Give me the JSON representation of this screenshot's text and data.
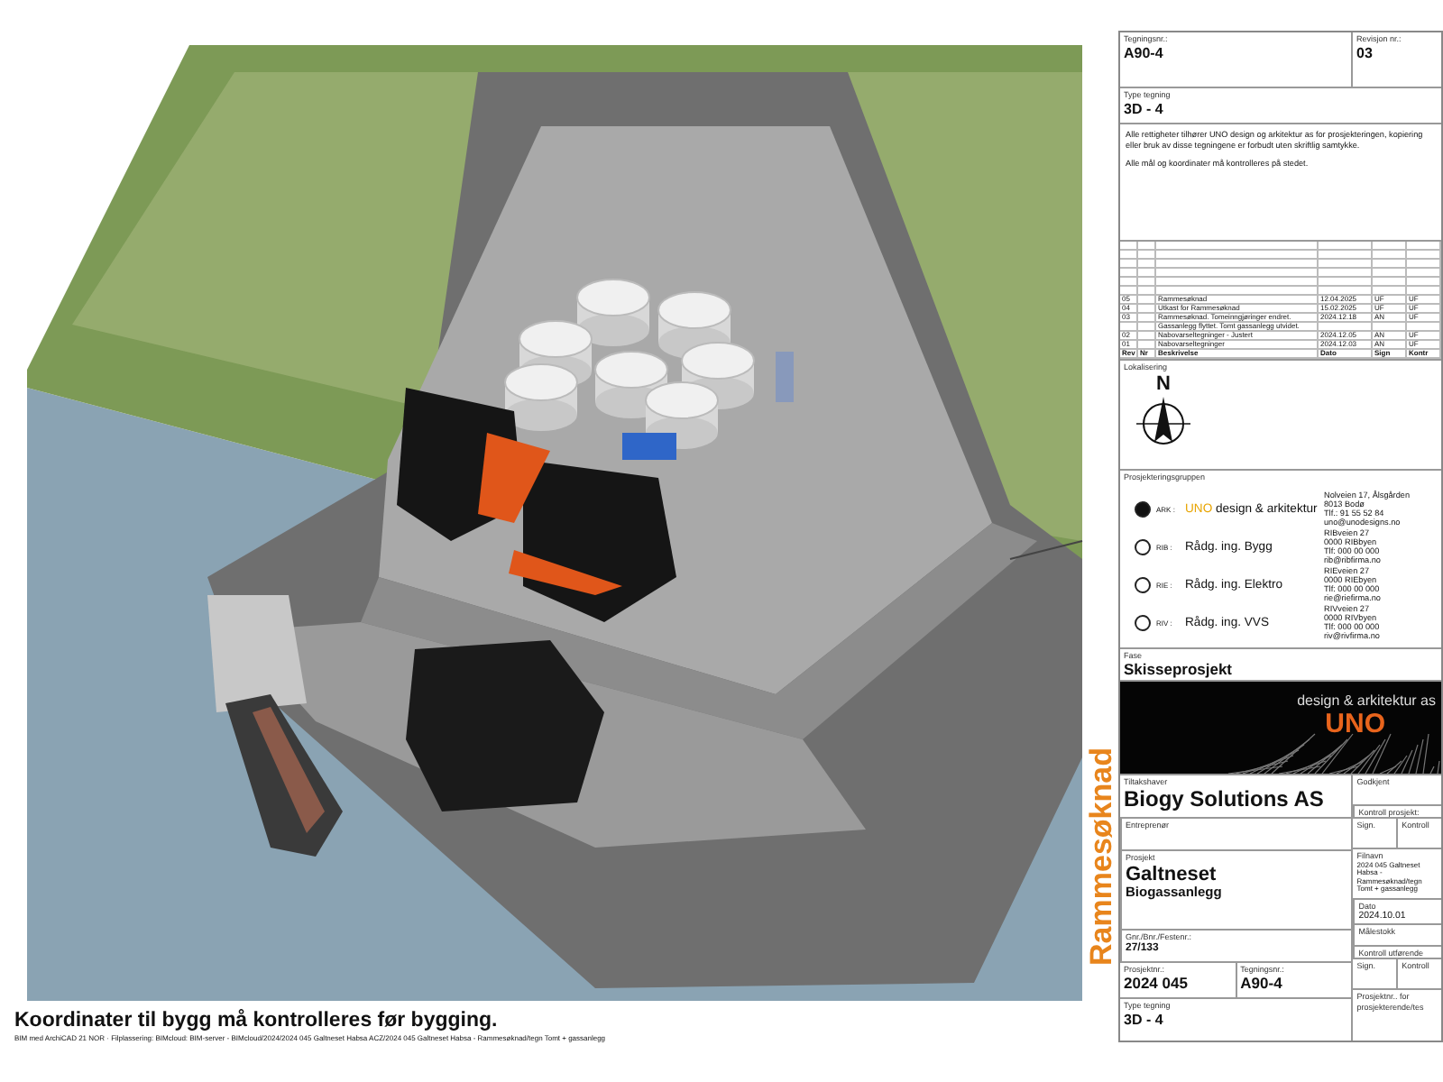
{
  "drawing": {
    "vertical_label": "Rammesøknad"
  },
  "notes": {
    "warning": "Koordinater til bygg må kontrolleres før bygging.",
    "file_path": "BIM med ArchiCAD 21 NOR · Filplassering: BIMcloud: BIM-server - BIMcloud/2024/2024 045 Galtneset Habsa ACZ/2024 045 Galtneset Habsa - Rammesøknad/tegn Tomt + gassanlegg"
  },
  "title_block": {
    "drawing_no": {
      "label": "Tegningsnr.:",
      "value": "A90-4"
    },
    "revision_no": {
      "label": "Revisjon nr.:",
      "value": "03"
    },
    "drawing_type": {
      "label": "Type tegning",
      "value": "3D - 4"
    },
    "disclaimers": [
      "Alle rettigheter tilhører UNO design og arkitektur as for prosjekteringen, kopiering eller bruk av disse tegningene er forbudt uten skriftlig samtykke.",
      "Alle mål og koordinater må kontrolleres på stedet."
    ],
    "revisions": {
      "columns": [
        "Rev",
        "Nr",
        "Beskrivelse",
        "Dato",
        "Sign",
        "Kontr"
      ],
      "rows": [
        {
          "rev": "05",
          "description": "Rammesøknad",
          "date": "12.04.2025",
          "sign": "UF",
          "kontr": "UF"
        },
        {
          "rev": "04",
          "description": "Utkast for Rammesøknad",
          "date": "15.02.2025",
          "sign": "UF",
          "kontr": "UF"
        },
        {
          "rev": "03",
          "description": "Rammesøknad. Tomeinngjøringer endret.",
          "date": "2024.12.18",
          "sign": "AN",
          "kontr": "UF"
        },
        {
          "description": "Gassanlegg flyttet. Tomt gassanlegg utvidet."
        },
        {
          "rev": "02",
          "description": "Nabovarseltegninger - Justert",
          "date": "2024.12.05",
          "sign": "AN",
          "kontr": "UF"
        },
        {
          "rev": "01",
          "description": "Nabovarseltegninger",
          "date": "2024.12.03",
          "sign": "AN",
          "kontr": "UF"
        }
      ]
    },
    "location": {
      "label": "Lokalisering",
      "north": "N"
    },
    "project_group": {
      "label": "Prosjekteringsgruppen",
      "members": [
        {
          "selected": true,
          "role": "ARK :",
          "brand": "UNO",
          "name": "design & arkitektur",
          "contact": [
            "Nolveien 17, Ålsgården",
            "8013 Bodø",
            "Tlf.: 91 55 52 84",
            "uno@unodesigns.no"
          ]
        },
        {
          "selected": false,
          "role": "RIB :",
          "name": "Rådg. ing. Bygg",
          "contact": [
            "RIBveien 27",
            "0000 RIBbyen",
            "Tlf: 000 00 000",
            "rib@ribfirma.no"
          ]
        },
        {
          "selected": false,
          "role": "RIE :",
          "name": "Rådg. ing. Elektro",
          "contact": [
            "RIEveien 27",
            "0000 RIEbyen",
            "Tlf: 000 00 000",
            "rie@riefirma.no"
          ]
        },
        {
          "selected": false,
          "role": "RIV :",
          "name": "Rådg. ing. VVS",
          "contact": [
            "RIVveien 27",
            "0000 RIVbyen",
            "Tlf: 000 00 000",
            "riv@rivfirma.no"
          ]
        }
      ]
    },
    "phase": {
      "label": "Fase",
      "value": "Skisseprosjekt"
    },
    "logo": {
      "tagline": "design & arkitektur as",
      "brand": "UNO"
    },
    "client": {
      "label": "Tiltakshaver",
      "value": "Biogy Solutions AS"
    },
    "contractor": {
      "label": "Entreprenør"
    },
    "project": {
      "label": "Prosjekt",
      "name": "Galtneset",
      "subtitle": "Biogassanlegg"
    },
    "property": {
      "label": "Gnr./Bnr./Festenr.:",
      "value": "27/133"
    },
    "project_no": {
      "label": "Prosjektnr.:",
      "value": "2024 045"
    },
    "drawing_no_bottom": {
      "label": "Tegningsnr.:",
      "value": "A90-4"
    },
    "drawing_type_bottom": {
      "label": "Type tegning",
      "value": "3D - 4"
    },
    "approved": {
      "label": "Godkjent"
    },
    "project_control": {
      "label": "Kontroll prosjekt:",
      "sign": "Sign.",
      "control": "Kontroll"
    },
    "file_name": {
      "label": "Filnavn",
      "value": "2024 045 Galtneset Habsa - Rammesøknad/tegn Tomt + gassanlegg"
    },
    "date": {
      "label": "Dato",
      "value": "2024.10.01"
    },
    "scale": {
      "label": "Målestokk"
    },
    "execution_control": {
      "label": "Kontroll utførende",
      "sign": "Sign.",
      "control": "Kontroll"
    },
    "designer_project_no": {
      "label": "Prosjektnr.. for prosjekterende/tes"
    }
  }
}
